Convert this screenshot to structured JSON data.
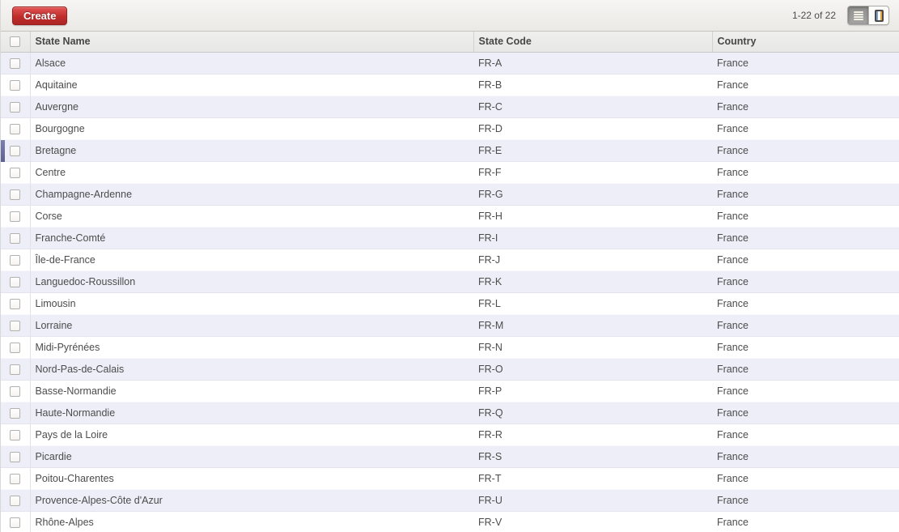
{
  "toolbar": {
    "create_label": "Create",
    "pager_text": "1-22 of 22",
    "view_switcher": {
      "list_active": true,
      "icons": [
        "list-view-icon",
        "form-view-icon"
      ]
    }
  },
  "colors": {
    "accent_red": "#c02c2c",
    "row_stripe": "#eeeef8",
    "row_marker": "#696d9b",
    "text": "#4c4c4c"
  },
  "table": {
    "columns": [
      "State Name",
      "State Code",
      "Country"
    ],
    "cursor_row_index": 4,
    "rows": [
      {
        "name": "Alsace",
        "code": "FR-A",
        "country": "France"
      },
      {
        "name": "Aquitaine",
        "code": "FR-B",
        "country": "France"
      },
      {
        "name": "Auvergne",
        "code": "FR-C",
        "country": "France"
      },
      {
        "name": "Bourgogne",
        "code": "FR-D",
        "country": "France"
      },
      {
        "name": "Bretagne",
        "code": "FR-E",
        "country": "France"
      },
      {
        "name": "Centre",
        "code": "FR-F",
        "country": "France"
      },
      {
        "name": "Champagne-Ardenne",
        "code": "FR-G",
        "country": "France"
      },
      {
        "name": "Corse",
        "code": "FR-H",
        "country": "France"
      },
      {
        "name": "Franche-Comté",
        "code": "FR-I",
        "country": "France"
      },
      {
        "name": "Île-de-France",
        "code": "FR-J",
        "country": "France"
      },
      {
        "name": "Languedoc-Roussillon",
        "code": "FR-K",
        "country": "France"
      },
      {
        "name": "Limousin",
        "code": "FR-L",
        "country": "France"
      },
      {
        "name": "Lorraine",
        "code": "FR-M",
        "country": "France"
      },
      {
        "name": "Midi-Pyrénées",
        "code": "FR-N",
        "country": "France"
      },
      {
        "name": "Nord-Pas-de-Calais",
        "code": "FR-O",
        "country": "France"
      },
      {
        "name": "Basse-Normandie",
        "code": "FR-P",
        "country": "France"
      },
      {
        "name": "Haute-Normandie",
        "code": "FR-Q",
        "country": "France"
      },
      {
        "name": "Pays de la Loire",
        "code": "FR-R",
        "country": "France"
      },
      {
        "name": "Picardie",
        "code": "FR-S",
        "country": "France"
      },
      {
        "name": "Poitou-Charentes",
        "code": "FR-T",
        "country": "France"
      },
      {
        "name": "Provence-Alpes-Côte d'Azur",
        "code": "FR-U",
        "country": "France"
      },
      {
        "name": "Rhône-Alpes",
        "code": "FR-V",
        "country": "France"
      }
    ]
  }
}
